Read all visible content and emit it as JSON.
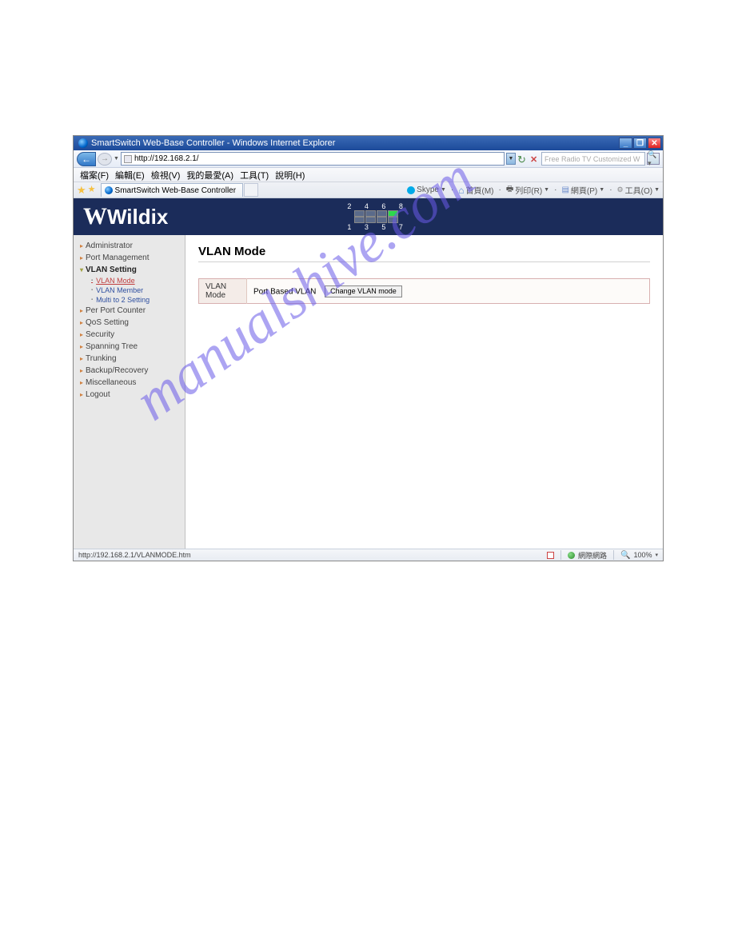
{
  "browser": {
    "title": "SmartSwitch Web-Base Controller - Windows Internet Explorer",
    "url": "http://192.168.2.1/",
    "search_placeholder": "Free Radio TV Customized W",
    "menu": [
      "檔案(F)",
      "編輯(E)",
      "檢視(V)",
      "我的最愛(A)",
      "工具(T)",
      "說明(H)"
    ],
    "tab_title": "SmartSwitch Web-Base Controller",
    "toolbar": {
      "skype": "Skype",
      "home": "首頁(M)",
      "print": "列印(R)",
      "page": "網頁(P)",
      "tools": "工具(O)"
    }
  },
  "ports": {
    "top_nums": "2 4 6 8",
    "bot_nums": "1 3 5 7",
    "active_index": 3
  },
  "logo": "Wildix",
  "sidebar": {
    "items": [
      {
        "label": "Administrator"
      },
      {
        "label": "Port Management"
      },
      {
        "label": "VLAN Setting",
        "active": true,
        "open": true,
        "children": [
          {
            "label": "VLAN Mode",
            "current": true
          },
          {
            "label": "VLAN Member"
          },
          {
            "label": "Multi to 2 Setting"
          }
        ]
      },
      {
        "label": "Per Port Counter"
      },
      {
        "label": "QoS Setting"
      },
      {
        "label": "Security"
      },
      {
        "label": "Spanning Tree"
      },
      {
        "label": "Trunking"
      },
      {
        "label": "Backup/Recovery"
      },
      {
        "label": "Miscellaneous"
      },
      {
        "label": "Logout"
      }
    ]
  },
  "content": {
    "title": "VLAN Mode",
    "row_label": "VLAN Mode",
    "row_value": "Port Based VLAN",
    "button": "Change VLAN mode"
  },
  "statusbar": {
    "left": "http://192.168.2.1/VLANMODE.htm",
    "zone": "網際網路",
    "zoom": "100%"
  },
  "watermark": "manualshive.com"
}
